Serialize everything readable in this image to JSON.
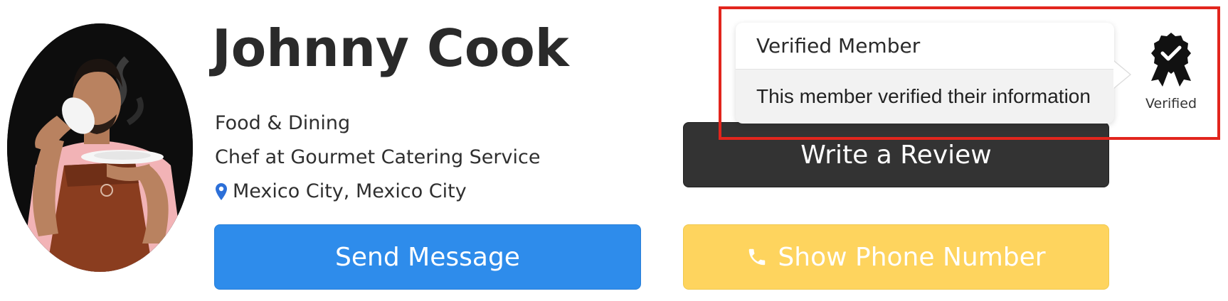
{
  "profile": {
    "name": "Johnny Cook",
    "category": "Food & Dining",
    "job": "Chef at Gourmet Catering Service",
    "location": "Mexico City, Mexico City"
  },
  "actions": {
    "send_message": "Send Message",
    "write_review": "Write a Review",
    "show_phone": "Show Phone Number"
  },
  "verification": {
    "tooltip_title": "Verified Member",
    "tooltip_text": "This member verified their information",
    "badge_label": "Verified"
  },
  "icons": {
    "location": "map-pin-icon",
    "phone": "phone-icon",
    "badge": "verified-award-icon"
  },
  "colors": {
    "send_message_bg": "#2e8ceb",
    "write_review_bg": "#333333",
    "show_phone_bg": "#fed45e",
    "pin": "#2c6fd8",
    "highlight": "#e2251d"
  }
}
